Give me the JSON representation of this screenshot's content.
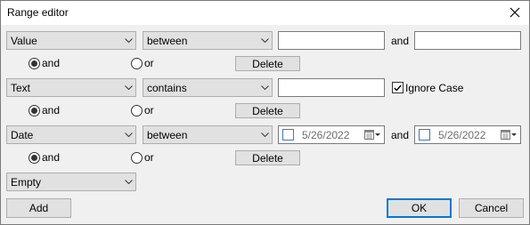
{
  "window": {
    "title": "Range editor"
  },
  "row1": {
    "field": "Value",
    "operator": "between",
    "value1": "",
    "and_label": "and",
    "value2": "",
    "radio_and": "and",
    "radio_or": "or",
    "delete_label": "Delete"
  },
  "row2": {
    "field": "Text",
    "operator": "contains",
    "value1": "",
    "ignore_case_label": "Ignore Case",
    "radio_and": "and",
    "radio_or": "or",
    "delete_label": "Delete"
  },
  "row3": {
    "field": "Date",
    "operator": "between",
    "date1": "5/26/2022",
    "and_label": "and",
    "date2": "5/26/2022",
    "radio_and": "and",
    "radio_or": "or",
    "delete_label": "Delete"
  },
  "row4": {
    "field": "Empty"
  },
  "footer": {
    "add_label": "Add",
    "ok_label": "OK",
    "cancel_label": "Cancel"
  },
  "state": {
    "row1_radio_selected": "and",
    "row2_radio_selected": "and",
    "row3_radio_selected": "and",
    "ignore_case_checked": true
  },
  "colors": {
    "accent": "#0078d7",
    "button_bg": "#e1e1e1",
    "dialog_bg": "#f0f0f0"
  }
}
